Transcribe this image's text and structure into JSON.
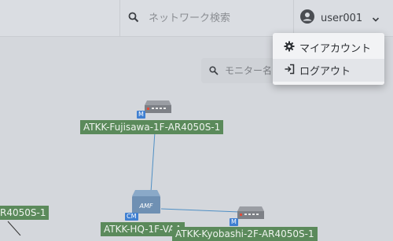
{
  "header": {
    "search_placeholder": "ネットワーク検索",
    "user_name": "user001"
  },
  "user_menu": {
    "items": [
      {
        "label": "マイアカウント",
        "icon": "gear-icon"
      },
      {
        "label": "ログアウト",
        "icon": "logout-icon"
      }
    ]
  },
  "map": {
    "monitor_search_placeholder": "モニター名",
    "nodes": [
      {
        "label": "ATKK-Fujisawa-1F-AR4050S-1",
        "badge": "M",
        "type": "router"
      },
      {
        "label": "ATKK-HQ-1F-VAA",
        "badge": "CM",
        "type": "amf"
      },
      {
        "label": "ATKK-Kyobashi-2F-AR4050S-1",
        "badge": "M",
        "type": "router"
      },
      {
        "label": "R4050S-1",
        "type": "router"
      }
    ],
    "amf_device_text": "AMF"
  },
  "colors": {
    "node_label_bg": "#5b8a5b",
    "badge_bg": "#3f7fd1",
    "link": "#4f8fc4"
  }
}
